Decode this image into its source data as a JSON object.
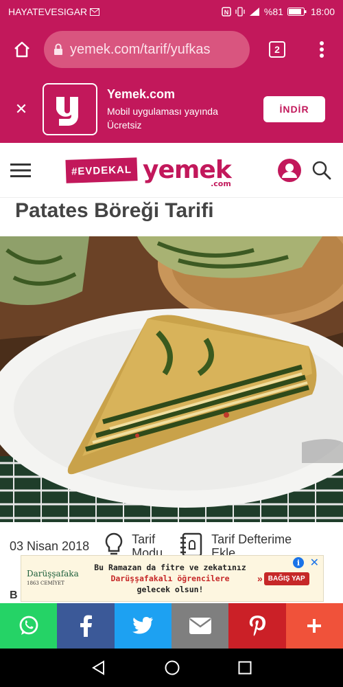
{
  "status_bar": {
    "carrier": "HAYATEVESIGAR",
    "battery": "%81",
    "time": "18:00"
  },
  "browser": {
    "url": "yemek.com/tarif/yufkas",
    "tab_count": "2"
  },
  "app_banner": {
    "title": "Yemek.com",
    "subtitle": "Mobil uygulaması yayında",
    "price": "Ücretsiz",
    "install_label": "İNDİR"
  },
  "site_header": {
    "campaign_tag": "#EVDEKAL",
    "logo": "yemek",
    "logo_suffix": ".com"
  },
  "recipe": {
    "title": "Patates Böreği Tarifi",
    "date": "03 Nisan 2018",
    "mode_label": "Tarif Modu",
    "save_label": "Tarif Defterime Ekle"
  },
  "ad": {
    "brand": "Darüşşafaka",
    "brand_sub": "1863        CEMİYET",
    "line1": "Bu Ramazan da fitre ve zekatınız",
    "line2": "Darüşşafakalı öğrencilere",
    "line3": "gelecek olsun!",
    "cta": "BAĞIŞ YAP"
  },
  "side_letter": "B",
  "colors": {
    "brand": "#c2185b",
    "whatsapp": "#25d366",
    "facebook": "#3b5998",
    "twitter": "#1da1f2",
    "email": "#7f7f7f",
    "pinterest": "#cb2027",
    "more": "#f0523a"
  },
  "share_icons": [
    "whatsapp-icon",
    "facebook-icon",
    "twitter-icon",
    "email-icon",
    "pinterest-icon",
    "plus-icon"
  ]
}
